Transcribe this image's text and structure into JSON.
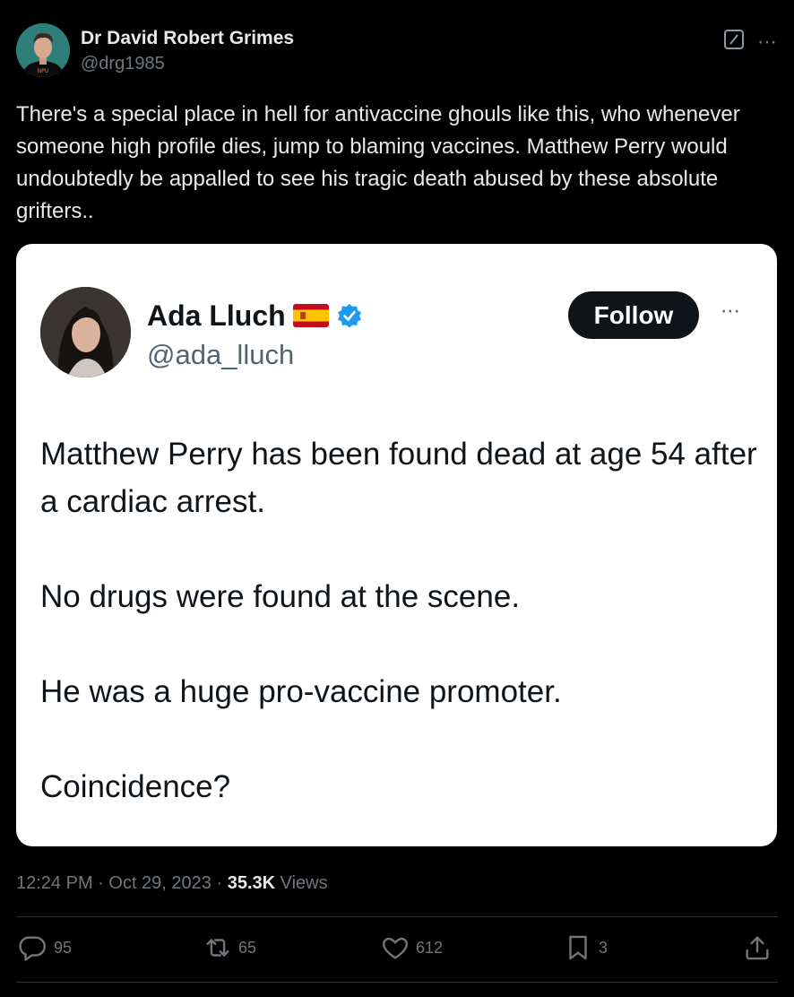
{
  "author": {
    "display_name": "Dr David Robert Grimes",
    "handle": "@drg1985",
    "avatar_icon": "profile-photo"
  },
  "tweet": {
    "text": "There's a special place in hell for antivaccine ghouls like this, who whenever someone high profile dies, jump to blaming vaccines. Matthew Perry would undoubtedly be appalled to see his tragic death abused by these absolute grifters.."
  },
  "quoted": {
    "display_name": "Ada Lluch",
    "handle": "@ada_lluch",
    "flag_icon": "spain-flag-icon",
    "verified_icon": "verified-badge-icon",
    "follow_label": "Follow",
    "paragraphs": [
      "Matthew Perry has been found dead at age 54 after a cardiac arrest.",
      "No drugs were found at the scene.",
      "He was a huge pro-vaccine promoter.",
      "Coincidence?"
    ]
  },
  "meta": {
    "time": "12:24 PM",
    "separator": " · ",
    "date": "Oct 29, 2023",
    "views_count": "35.3K",
    "views_label": " Views"
  },
  "actions": {
    "replies": "95",
    "reposts": "65",
    "likes": "612",
    "bookmarks": "3"
  },
  "colors": {
    "background": "#000000",
    "text_primary": "#e7e9ea",
    "text_secondary": "#71767b",
    "card_background": "#ffffff",
    "verified_blue": "#1d9bf0",
    "follow_button": "#0f1419"
  }
}
